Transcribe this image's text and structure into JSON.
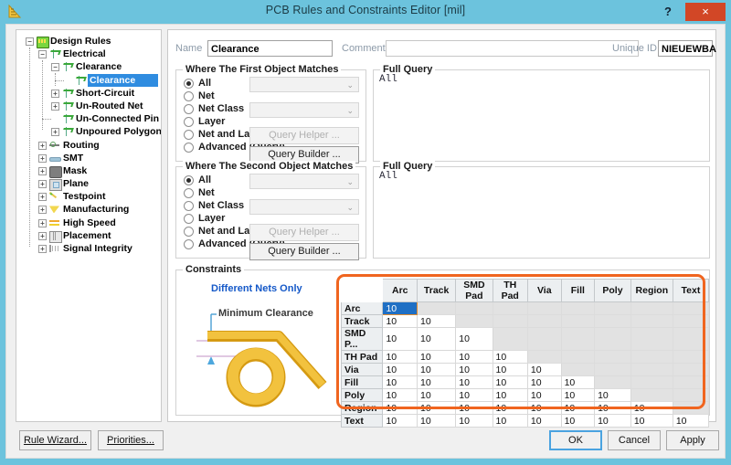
{
  "window": {
    "title": "PCB Rules and Constraints Editor [mil]",
    "icon": "ruler-icon",
    "help_label": "?",
    "close_label": "×"
  },
  "tree": {
    "items": [
      {
        "label": "Design Rules",
        "depth": 0,
        "expander": "-",
        "icon": "design-rules-folder-icon",
        "selected": false
      },
      {
        "label": "Electrical",
        "depth": 1,
        "expander": "-",
        "icon": "electrical-icon",
        "selected": false
      },
      {
        "label": "Clearance",
        "depth": 2,
        "expander": "-",
        "icon": "electrical-icon",
        "selected": false
      },
      {
        "label": "Clearance",
        "depth": 3,
        "expander": "",
        "icon": "electrical-icon",
        "selected": true
      },
      {
        "label": "Short-Circuit",
        "depth": 2,
        "expander": "+",
        "icon": "electrical-icon",
        "selected": false
      },
      {
        "label": "Un-Routed Net",
        "depth": 2,
        "expander": "+",
        "icon": "electrical-icon",
        "selected": false
      },
      {
        "label": "Un-Connected Pin",
        "depth": 2,
        "expander": "",
        "icon": "electrical-icon",
        "selected": false
      },
      {
        "label": "Unpoured Polygon",
        "depth": 2,
        "expander": "+",
        "icon": "electrical-icon",
        "selected": false
      },
      {
        "label": "Routing",
        "depth": 1,
        "expander": "+",
        "icon": "routing-icon",
        "selected": false
      },
      {
        "label": "SMT",
        "depth": 1,
        "expander": "+",
        "icon": "smt-icon",
        "selected": false
      },
      {
        "label": "Mask",
        "depth": 1,
        "expander": "+",
        "icon": "mask-icon",
        "selected": false
      },
      {
        "label": "Plane",
        "depth": 1,
        "expander": "+",
        "icon": "plane-icon",
        "selected": false
      },
      {
        "label": "Testpoint",
        "depth": 1,
        "expander": "+",
        "icon": "testpoint-icon",
        "selected": false
      },
      {
        "label": "Manufacturing",
        "depth": 1,
        "expander": "+",
        "icon": "manufacturing-icon",
        "selected": false
      },
      {
        "label": "High Speed",
        "depth": 1,
        "expander": "+",
        "icon": "high-speed-icon",
        "selected": false
      },
      {
        "label": "Placement",
        "depth": 1,
        "expander": "+",
        "icon": "placement-icon",
        "selected": false
      },
      {
        "label": "Signal Integrity",
        "depth": 1,
        "expander": "+",
        "icon": "signal-integrity-icon",
        "selected": false
      }
    ]
  },
  "identification": {
    "name_label": "Name",
    "name_value": "Clearance",
    "comment_label": "Comment",
    "comment_value": "",
    "unique_id_label": "Unique ID",
    "unique_id_value": "NIEUEWBA"
  },
  "first_object": {
    "title": "Where The First Object Matches",
    "options": [
      "All",
      "Net",
      "Net Class",
      "Layer",
      "Net and Layer",
      "Advanced (Query)"
    ],
    "selected": "All",
    "net_combo_value": "",
    "netclass_combo_value": "",
    "query_helper_label": "Query Helper ...",
    "query_builder_label": "Query Builder ...",
    "full_query_label": "Full Query",
    "full_query_text": "All"
  },
  "second_object": {
    "title": "Where The Second Object Matches",
    "options": [
      "All",
      "Net",
      "Net Class",
      "Layer",
      "Net and Layer",
      "Advanced (Query)"
    ],
    "selected": "All",
    "net_combo_value": "",
    "netclass_combo_value": "",
    "query_helper_label": "Query Helper ...",
    "query_builder_label": "Query Builder ...",
    "full_query_label": "Full Query",
    "full_query_text": "All"
  },
  "constraints": {
    "title": "Constraints",
    "diagram_title": "Different Nets Only",
    "diagram_caption": "Minimum Clearance",
    "highlight_color": "#f0651f",
    "matrix": {
      "columns": [
        "Arc",
        "Track",
        "SMD Pad",
        "TH Pad",
        "Via",
        "Fill",
        "Poly",
        "Region",
        "Text"
      ],
      "rows": [
        {
          "header": "Arc",
          "values": [
            "10"
          ]
        },
        {
          "header": "Track",
          "values": [
            "10",
            "10"
          ]
        },
        {
          "header": "SMD P...",
          "values": [
            "10",
            "10",
            "10"
          ]
        },
        {
          "header": "TH Pad",
          "values": [
            "10",
            "10",
            "10",
            "10"
          ]
        },
        {
          "header": "Via",
          "values": [
            "10",
            "10",
            "10",
            "10",
            "10"
          ]
        },
        {
          "header": "Fill",
          "values": [
            "10",
            "10",
            "10",
            "10",
            "10",
            "10"
          ]
        },
        {
          "header": "Poly",
          "values": [
            "10",
            "10",
            "10",
            "10",
            "10",
            "10",
            "10"
          ]
        },
        {
          "header": "Region",
          "values": [
            "10",
            "10",
            "10",
            "10",
            "10",
            "10",
            "10",
            "10"
          ]
        },
        {
          "header": "Text",
          "values": [
            "10",
            "10",
            "10",
            "10",
            "10",
            "10",
            "10",
            "10",
            "10"
          ]
        }
      ],
      "selected_cell": {
        "row": 0,
        "col": 0
      }
    }
  },
  "footer": {
    "rule_wizard_label": "Rule Wizard...",
    "priorities_label": "Priorities...",
    "ok_label": "OK",
    "cancel_label": "Cancel",
    "apply_label": "Apply"
  }
}
